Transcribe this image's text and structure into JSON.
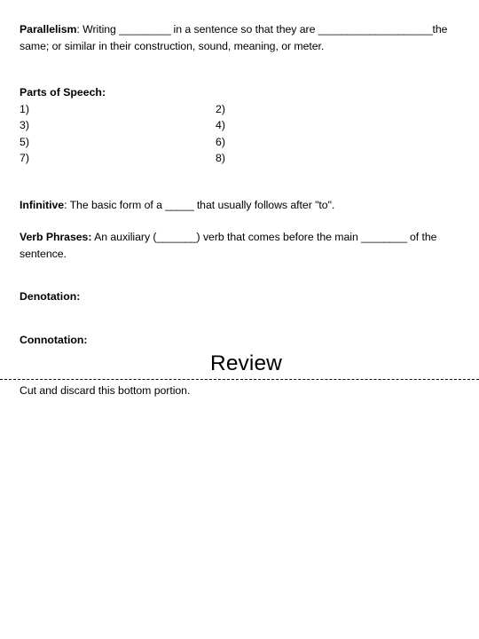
{
  "document": {
    "background_color": "#ffffff",
    "text_color": "#000000"
  },
  "parallelism": {
    "label": "Parallelism",
    "colon": ":",
    "text_part1": " Writing ",
    "blank1": "_________",
    "text_part2": " in a sentence so that they are",
    "blank2": "____________________",
    "text_part3": "the same; or similar in their construction, sound, meaning, or meter."
  },
  "parts_of_speech": {
    "heading": "Parts of Speech:",
    "rows": [
      {
        "left": "1)",
        "right": "2)"
      },
      {
        "left": "3)",
        "right": "4)"
      },
      {
        "left": "5)",
        "right": "6)"
      },
      {
        "left": "7)",
        "right": "8)"
      }
    ]
  },
  "infinitive": {
    "label": "Infinitive",
    "colon": ":",
    "text_part1": " The basic form of a ",
    "blank1": "_____",
    "text_part2": " that usually follows after \"to\"."
  },
  "verb_phrases": {
    "label": "Verb Phrases:",
    "text_part1": " An auxiliary (",
    "blank1": "_______",
    "text_part2": ") verb that comes before the main ",
    "blank2": "________",
    "text_part3": " of the sentence."
  },
  "denotation": {
    "label": "Denotation:"
  },
  "connotation": {
    "label": "Connotation:"
  },
  "review": {
    "title": "Review",
    "cut_note": "Cut and discard this bottom portion."
  }
}
